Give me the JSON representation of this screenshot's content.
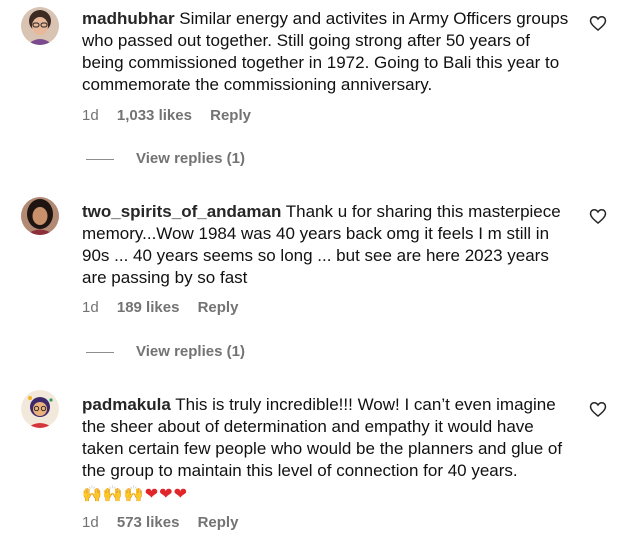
{
  "comments": [
    {
      "username": "madhubhar",
      "text": "Similar energy and activites in Army Officers groups who passed out together. Still going strong after 50 years of being commissioned together in 1972. Going to Bali this year to commemorate the commissioning anniversary.",
      "time": "1d",
      "likes": "1,033 likes",
      "reply_label": "Reply",
      "view_replies": "View replies (1)",
      "avatar_icon": "avatar-woman-glasses"
    },
    {
      "username": "two_spirits_of_andaman",
      "text": "Thank u for sharing this masterpiece memory...Wow 1984 was 40 years back omg it feels I m still in 90s ... 40 years seems so long ... but see are here 2023 years are passing by so fast",
      "time": "1d",
      "likes": "189 likes",
      "reply_label": "Reply",
      "view_replies": "View replies (1)",
      "avatar_icon": "avatar-woman-dark-hair"
    },
    {
      "username": "padmakula",
      "text": "This is truly incredible!!! Wow! I can’t even imagine the sheer about of determination and empathy it would have taken certain few people who would be the planners and glue of the group to maintain this level of connection for 40 years.",
      "emojis": [
        "🙌",
        "🙌",
        "🙌",
        "❤",
        "❤",
        "❤"
      ],
      "time": "1d",
      "likes": "573 likes",
      "reply_label": "Reply",
      "avatar_icon": "avatar-cartoon-person"
    }
  ],
  "colors": {
    "meta_gray": "#737373",
    "username": "#262626",
    "heart_red": "#e0252b"
  }
}
